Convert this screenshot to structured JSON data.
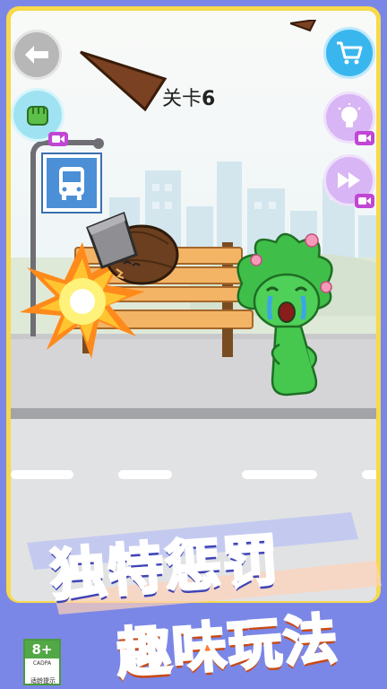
{
  "level": {
    "prefix": "关卡",
    "number": "6"
  },
  "buttons": {
    "back": {
      "icon": "back-arrow-icon"
    },
    "hand": {
      "icon": "green-fist-icon"
    },
    "shop": {
      "icon": "shopping-cart-icon"
    },
    "hint": {
      "icon": "lightbulb-icon"
    },
    "skip": {
      "icon": "fast-forward-icon"
    },
    "video_badge_icon": "video-camera-icon"
  },
  "scene": {
    "bus_sign_icon": "bus-icon",
    "character": "crying-green-plant-girl",
    "projectile": "metal-bucket-with-brown-ball"
  },
  "promo": {
    "line1": "独特惩罚",
    "line2": "趣味玩法"
  },
  "age_rating": {
    "rating": "8+",
    "org": "CADPA",
    "caption": "适龄提示"
  },
  "colors": {
    "frame": "#f7d94a",
    "background": "#7b87e6",
    "title1": "#6f74e8",
    "title2": "#ff7a3d",
    "accent_blue": "#3ab6ef",
    "accent_purple": "#d8b5f4"
  }
}
